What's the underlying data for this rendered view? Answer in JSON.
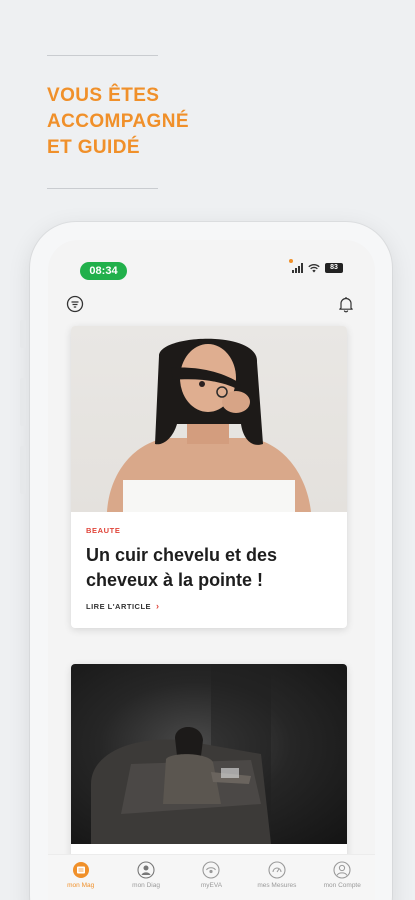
{
  "promo": {
    "headline_lines": [
      "VOUS ÊTES",
      "ACCOMPAGNÉ",
      "ET GUIDÉ"
    ]
  },
  "status_bar": {
    "time": "08:34",
    "battery": "83"
  },
  "header": {
    "menu_icon": "menu-circle-icon",
    "notification_icon": "bell-icon"
  },
  "articles": [
    {
      "category": "BEAUTE",
      "title": "Un cuir chevelu et des cheveux à la pointe !",
      "cta": "LIRE L'ARTICLE"
    },
    {
      "category": "",
      "title": "",
      "cta": ""
    }
  ],
  "tabbar": {
    "items": [
      {
        "label": "mon Mag",
        "icon": "magazine-icon",
        "active": true
      },
      {
        "label": "mon Diag",
        "icon": "diagnostic-icon",
        "active": false
      },
      {
        "label": "myEVA",
        "icon": "eva-icon",
        "active": false
      },
      {
        "label": "mes Mesures",
        "icon": "measures-icon",
        "active": false
      },
      {
        "label": "mon Compte",
        "icon": "account-icon",
        "active": false
      }
    ]
  },
  "colors": {
    "accent": "#f0902a",
    "category": "#e0453a",
    "time_pill": "#21b04b"
  }
}
